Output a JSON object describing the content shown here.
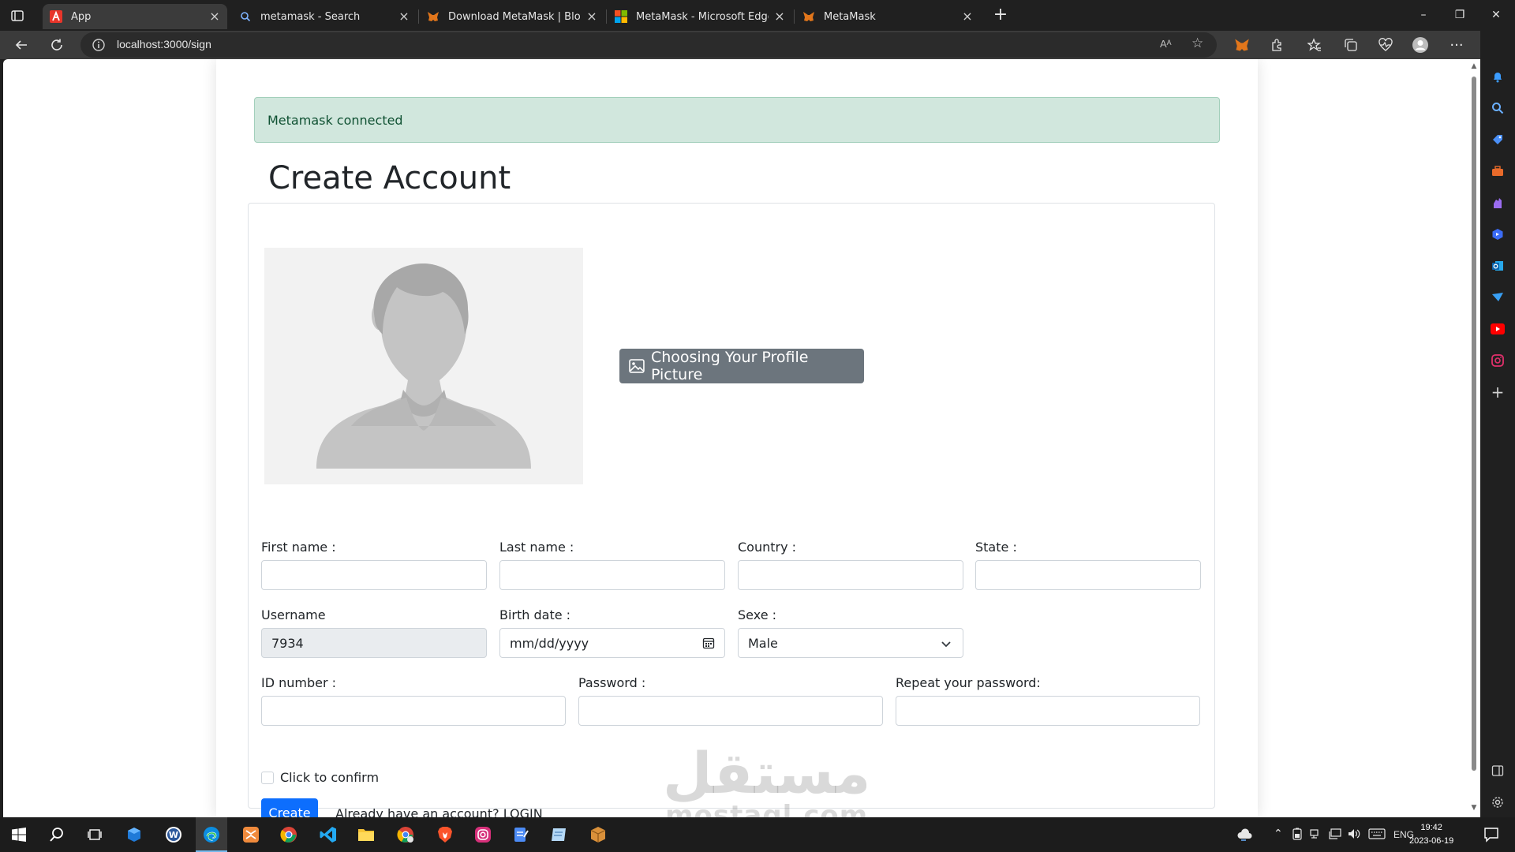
{
  "browser": {
    "tabs": [
      {
        "title": "App",
        "favicon": "app-icon",
        "active": true
      },
      {
        "title": "metamask - Search",
        "favicon": "search-icon",
        "active": false
      },
      {
        "title": "Download MetaMask | Blockchai",
        "favicon": "metamask-fox-icon",
        "active": false
      },
      {
        "title": "MetaMask - Microsoft Edge Add",
        "favicon": "microsoft-icon",
        "active": false
      },
      {
        "title": "MetaMask",
        "favicon": "metamask-fox-icon",
        "active": false
      }
    ],
    "url": "localhost:3000/sign",
    "read_aloud": "Aᴬ"
  },
  "page": {
    "alert": "Metamask connected",
    "title": "Create Account",
    "picture_button": "Choosing Your Profile Picture",
    "form": {
      "first_name_label": "First name :",
      "last_name_label": "Last name :",
      "country_label": "Country :",
      "state_label": "State :",
      "username_label": "Username",
      "username_value": "7934",
      "birth_label": "Birth date :",
      "birth_placeholder": "mm/dd/yyyy",
      "sexe_label": "Sexe :",
      "sexe_value": "Male",
      "id_label": "ID number :",
      "password_label": "Password :",
      "repeat_label": "Repeat your password:",
      "confirm_label": "Click to confirm",
      "create_button": "Create",
      "have_account": "Already have an account?",
      "login_link": "LOGIN"
    }
  },
  "watermark": {
    "arabic": "مستقل",
    "latin": "mostaql.com"
  },
  "taskbar": {
    "language": "ENG",
    "time": "19:42",
    "date": "2023-06-19"
  },
  "colors": {
    "alert_bg": "#d1e7dd",
    "primary": "#0d6efd",
    "secondary": "#6c757d"
  }
}
